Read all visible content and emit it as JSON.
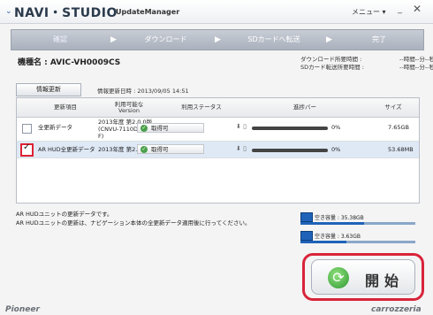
{
  "app": {
    "logo": "NAVI・STUDIO",
    "subtitle": "UpdateManager",
    "menu_label": "メニュー ▾",
    "minimize": "_",
    "close": "✕",
    "icon": "chevron-down-icon"
  },
  "steps": [
    {
      "label": "確認"
    },
    {
      "label": "ダウンロード"
    },
    {
      "label": "SDカードへ転送"
    },
    {
      "label": "完了"
    }
  ],
  "model": "機種名 : AVIC-VH0009CS",
  "times": {
    "download_label": "ダウンロード所要時間 :",
    "download_value": "--時間--分--秒",
    "transfer_label": "SDカード転送所要時間 :",
    "transfer_value": "--時間--分--秒"
  },
  "info": {
    "refresh_button": "情報更新",
    "date_text": "情報更新日時 : 2013/09/05 14:51"
  },
  "table": {
    "headers": [
      "更新項目",
      "利用可能な\nVersion",
      "利用ステータス",
      "進捗バー",
      "サイズ"
    ],
    "rows": [
      {
        "checked": false,
        "item": "全更新データ",
        "version": "2013年度 第2.0.0版\n(CNVU-7110DL-\nF)",
        "status": "取得可",
        "progress": 0,
        "percent": "0%",
        "size": "7.65GB"
      },
      {
        "checked": true,
        "item": "AR HUD全更新データ",
        "version": "2013年度 第2.0.0版",
        "status": "取得可",
        "progress": 0,
        "percent": "0%",
        "size": "53.68MB"
      }
    ]
  },
  "message": {
    "line1": "AR HUDユニットの更新データです。",
    "line2": "AR HUDユニットの更新は、ナビゲーション本体の全更新データ適用後に行ってください。"
  },
  "disk": {
    "pc_free": "空き容量 : 35.38GB",
    "sd_free": "空き容量 : 3.63GB",
    "pc_fill": 0.55,
    "sd_fill": 0.4
  },
  "start": {
    "label": "開始"
  },
  "footer": {
    "left": "Pioneer",
    "right": "carrozzeria"
  }
}
